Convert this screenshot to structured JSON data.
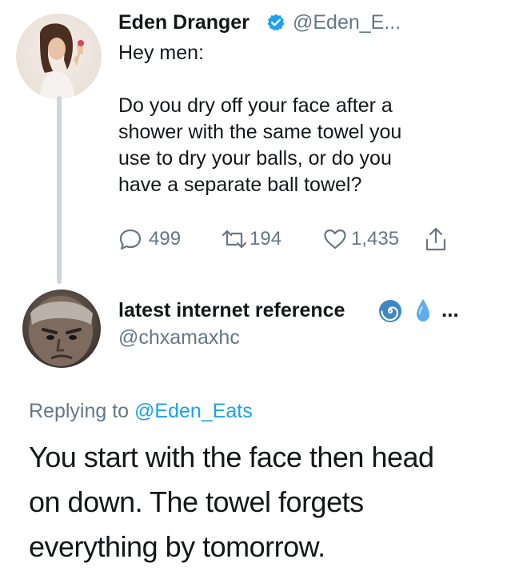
{
  "tweet1": {
    "name": "Eden Dranger",
    "handle": "@Eden_E...",
    "verified": true,
    "body_lines": [
      "Hey men:",
      "",
      "Do you dry off your face after a",
      "shower with the same towel you",
      "use to dry your balls, or do you",
      "have a separate ball towel?"
    ],
    "replies": "499",
    "retweets": "194",
    "likes": "1,435"
  },
  "tweet2": {
    "name": "latest internet reference",
    "handle": "@chxamaxhc",
    "more": "...",
    "replying_prefix": "Replying to",
    "replying_handle": "@Eden_Eats",
    "body_lines": [
      "You start with the face then head",
      "on down. The towel forgets",
      "everything by tomorrow."
    ]
  },
  "colors": {
    "text": "#14171a",
    "muted": "#657786",
    "link": "#1da1f2",
    "verified": "#1da1f2",
    "thread_line": "#ccd6dd"
  },
  "icons": [
    "verified-badge-icon",
    "reply-icon",
    "retweet-icon",
    "like-icon",
    "share-icon",
    "cyclone-emoji-icon",
    "droplet-emoji-icon"
  ]
}
